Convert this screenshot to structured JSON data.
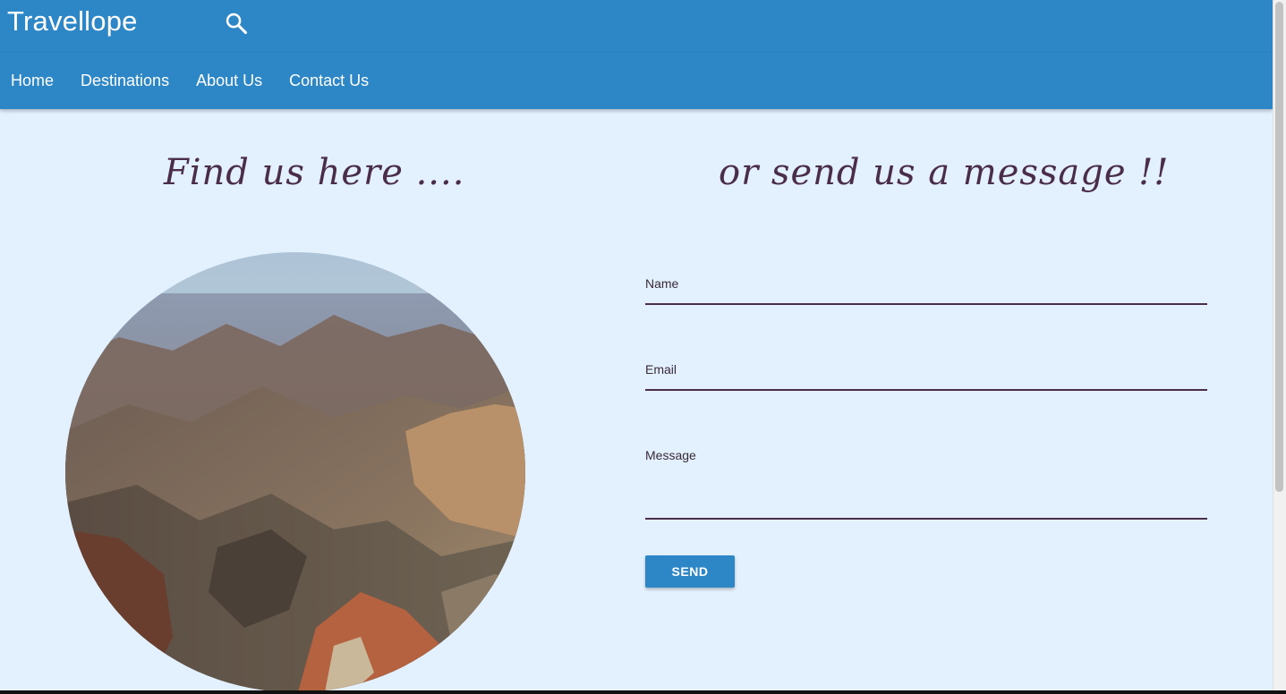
{
  "header": {
    "brand": "Travellope",
    "search_icon": "search-icon"
  },
  "nav": {
    "items": [
      {
        "label": "Home"
      },
      {
        "label": "Destinations"
      },
      {
        "label": "About Us"
      },
      {
        "label": "Contact Us"
      }
    ]
  },
  "main": {
    "left_heading": "Find us here ....",
    "right_heading": "or send us a message !!"
  },
  "form": {
    "name_label": "Name",
    "email_label": "Email",
    "message_label": "Message",
    "send_label": "SEND"
  },
  "colors": {
    "primary": "#2d87c7",
    "background": "#e3f0fd",
    "heading": "#4a2d48"
  }
}
